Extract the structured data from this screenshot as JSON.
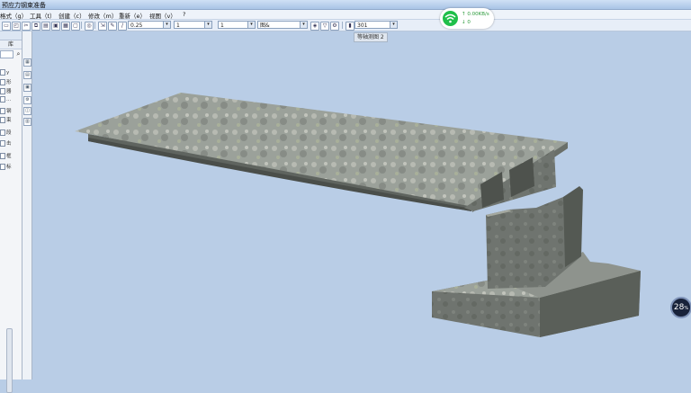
{
  "window": {
    "title": "预应力钢束准备"
  },
  "menu": [
    {
      "label": "格式（g）"
    },
    {
      "label": "工具（t）"
    },
    {
      "label": "创建（c）"
    },
    {
      "label": "修改（m）"
    },
    {
      "label": "重新（e）"
    },
    {
      "label": "视图（v）"
    },
    {
      "label": "?"
    }
  ],
  "toolbar": {
    "line_weight": "0.25",
    "line_scale": "1",
    "line_width": "1",
    "layer": "图&",
    "number": "301"
  },
  "tooltip": "等轴测图 2",
  "left_panel": {
    "tab": "库",
    "tree_items": [
      "y",
      "形",
      "器",
      "...",
      "钢",
      "束",
      "段",
      "击",
      "框",
      "标"
    ]
  },
  "network": {
    "upload": "0.00KB/s",
    "download": "0"
  },
  "badge": {
    "value": "28",
    "unit": "%"
  },
  "colors": {
    "background": "#b9cde6",
    "accent": "#1fbf4a",
    "concrete": "#8f948f"
  },
  "icons": [
    "search-icon",
    "wifi-icon",
    "dropdown-arrow-icon"
  ]
}
